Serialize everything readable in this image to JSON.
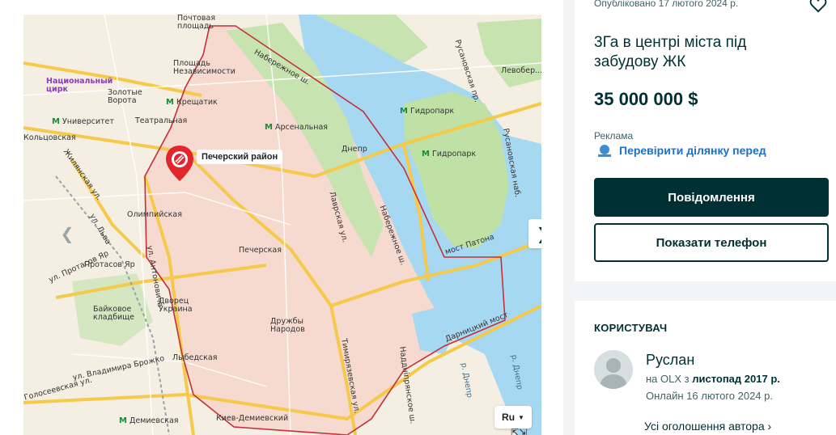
{
  "map": {
    "district_label": "Печерский район",
    "lang_selector": "Ru",
    "labels": [
      {
        "text": "Почтовая\nплощадь",
        "kind": "plain"
      },
      {
        "text": "Площадь\nНезависимости",
        "kind": "plain"
      },
      {
        "text": "Национальный\nцирк",
        "kind": "plain"
      },
      {
        "text": "Золотые\nВорота",
        "kind": "plain"
      },
      {
        "text": "Крещатик",
        "kind": "metro"
      },
      {
        "text": "Театральная",
        "kind": "plain"
      },
      {
        "text": "Университет",
        "kind": "metro"
      },
      {
        "text": "Арсенальная",
        "kind": "metro"
      },
      {
        "text": "Днепр",
        "kind": "plain"
      },
      {
        "text": "Гидропарк",
        "kind": "metro"
      },
      {
        "text": "Гидропарк",
        "kind": "metro"
      },
      {
        "text": "Олимпийская",
        "kind": "plain"
      },
      {
        "text": "Печерская",
        "kind": "plain"
      },
      {
        "text": "Протасов Яр",
        "kind": "plain"
      },
      {
        "text": "Дворец\nУкраина",
        "kind": "plain"
      },
      {
        "text": "Байковое\nкладбище",
        "kind": "plain"
      },
      {
        "text": "Дружбы\nНародов",
        "kind": "plain"
      },
      {
        "text": "Лыбедская",
        "kind": "plain"
      },
      {
        "text": "Демиевская",
        "kind": "metro"
      },
      {
        "text": "Киев-Демиевский",
        "kind": "plain"
      },
      {
        "text": "Левобер...",
        "kind": "plain"
      },
      {
        "text": "мост Патона",
        "kind": "plain"
      },
      {
        "text": "Дарницкий мост",
        "kind": "plain"
      },
      {
        "text": "р. Днепр",
        "kind": "water"
      },
      {
        "text": "р. Днепр",
        "kind": "water"
      },
      {
        "text": "Набережное ш.",
        "kind": "plain"
      },
      {
        "text": "Набережное ш.",
        "kind": "plain"
      },
      {
        "text": "Лаврская ул.",
        "kind": "plain"
      },
      {
        "text": "Тимирязевская ул.",
        "kind": "plain"
      },
      {
        "text": "Наддніпрянское ш.",
        "kind": "plain"
      },
      {
        "text": "Русановская пр.",
        "kind": "plain"
      },
      {
        "text": "Русановская наб.",
        "kind": "plain"
      },
      {
        "text": "ул. Антоновича",
        "kind": "plain"
      },
      {
        "text": "Жилянская ул.",
        "kind": "plain"
      },
      {
        "text": "ул. Протасов Яр",
        "kind": "plain"
      },
      {
        "text": "ул. Владимира Брожко",
        "kind": "plain"
      },
      {
        "text": "Голосеевская ул.",
        "kind": "plain"
      },
      {
        "text": "ул. Льва",
        "kind": "plain"
      },
      {
        "text": "Кольцовская",
        "kind": "plain"
      }
    ]
  },
  "listing": {
    "published": "Опубліковано 17 лютого 2024 р.",
    "title": "3Га в центрі міста під забудову ЖК",
    "price": "35 000 000 $",
    "ad_label": "Реклама",
    "ad_link": "Перевірити ділянку перед",
    "message_button": "Повідомлення",
    "phone_button": "Показати телефон"
  },
  "user": {
    "heading": "КОРИСТУВАЧ",
    "name": "Руслан",
    "since_prefix": "на OLX з ",
    "since_date": "листопад 2017 р.",
    "online": "Онлайн 16 лютого 2024 р.",
    "all_ads": "Усі оголошення автора"
  },
  "colors": {
    "brand_dark": "#002f34",
    "link_blue": "#1f6fc7",
    "river": "#a7d8f2",
    "park": "#bfe1a6",
    "district_fill": "#f6d9cf",
    "boundary": "#c4303a"
  }
}
